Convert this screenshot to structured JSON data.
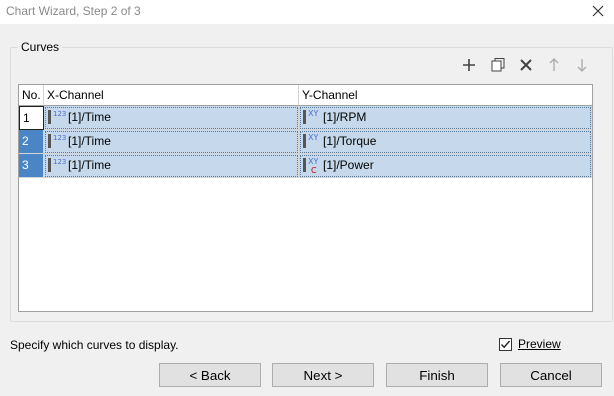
{
  "window": {
    "title": "Chart Wizard, Step 2 of 3"
  },
  "group": {
    "label": "Curves"
  },
  "toolbar": {
    "icons": [
      "add-icon",
      "copy-icon",
      "delete-icon",
      "move-up-icon",
      "move-down-icon"
    ]
  },
  "table": {
    "headers": {
      "no": "No.",
      "x": "X-Channel",
      "y": "Y-Channel"
    },
    "rows": [
      {
        "no": "1",
        "x": "[1]/Time",
        "y": "[1]/RPM"
      },
      {
        "no": "2",
        "x": "[1]/Time",
        "y": "[1]/Torque"
      },
      {
        "no": "3",
        "x": "[1]/Time",
        "y": "[1]/Power"
      }
    ],
    "icon_labels": {
      "numeric": "123",
      "xy": "XY",
      "computed_marker": "C"
    }
  },
  "hint": "Specify which curves to display.",
  "preview": {
    "label": "Preview",
    "checked": true
  },
  "buttons": {
    "back": "< Back",
    "next": "Next >",
    "finish": "Finish",
    "cancel": "Cancel"
  },
  "colors": {
    "selection": "#c6d9ec",
    "row_header_highlight": "#4a86c5",
    "computed_marker": "#cc0000"
  }
}
